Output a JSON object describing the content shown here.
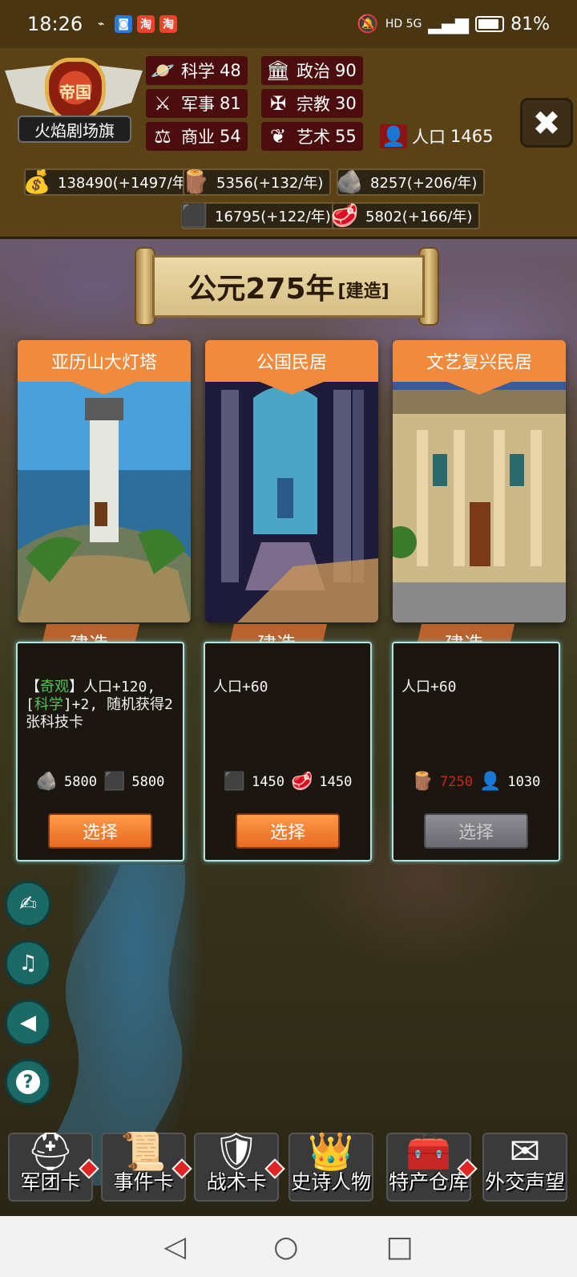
{
  "status_bar": {
    "time": "18:26",
    "apps": [
      "⌁",
      "◙",
      "淘",
      "淘"
    ],
    "battery": "81%",
    "signal": "HD 5G"
  },
  "empire": {
    "shield_label": "帝国",
    "name": "火焰剧场旗"
  },
  "stats": [
    {
      "icon": "science-icon",
      "label": "科学",
      "value": "48"
    },
    {
      "icon": "politics-icon",
      "label": "政治",
      "value": "90"
    },
    {
      "icon": "military-icon",
      "label": "军事",
      "value": "81"
    },
    {
      "icon": "religion-icon",
      "label": "宗教",
      "value": "30"
    },
    {
      "icon": "commerce-icon",
      "label": "商业",
      "value": "54"
    },
    {
      "icon": "art-icon",
      "label": "艺术",
      "value": "55"
    },
    {
      "icon": "population-icon",
      "label": "人口",
      "value": "1465"
    }
  ],
  "resources": [
    {
      "icon": "gold-icon",
      "text": "138490(+1497/年)"
    },
    {
      "icon": "wood-icon",
      "text": "5356(+132/年)"
    },
    {
      "icon": "stone-icon",
      "text": "8257(+206/年)"
    },
    {
      "icon": "iron-icon",
      "text": "16795(+122/年)"
    },
    {
      "icon": "meat-icon",
      "text": "5802(+166/年)"
    }
  ],
  "title_scroll": {
    "era": "公元275年",
    "mode": "[建造]"
  },
  "cards": [
    {
      "title": "亚历山大灯塔",
      "build_label": "建造",
      "desc_parts": [
        "【",
        "奇观",
        "】人口+120,",
        "[",
        "科学",
        "]+2, 随机获得2张科技卡"
      ],
      "costs": [
        {
          "icon": "stone-icon",
          "value": "5800",
          "short": false
        },
        {
          "icon": "iron-icon",
          "value": "5800",
          "short": false
        }
      ],
      "button": "选择",
      "enabled": true
    },
    {
      "title": "公国民居",
      "build_label": "建造",
      "desc": "人口+60",
      "costs": [
        {
          "icon": "iron-icon",
          "value": "1450",
          "short": false
        },
        {
          "icon": "meat-icon",
          "value": "1450",
          "short": false
        }
      ],
      "button": "选择",
      "enabled": true
    },
    {
      "title": "文艺复兴民居",
      "build_label": "建造",
      "desc": "人口+60",
      "costs": [
        {
          "icon": "wood-icon",
          "value": "7250",
          "short": true
        },
        {
          "icon": "population-icon",
          "value": "1030",
          "short": false
        }
      ],
      "button": "选择",
      "enabled": false
    }
  ],
  "side_buttons": [
    {
      "icon": "book-quill-icon"
    },
    {
      "icon": "music-off-icon"
    },
    {
      "icon": "speaker-icon"
    },
    {
      "icon": "help-icon"
    }
  ],
  "bottom_nav": [
    {
      "label": "军团卡",
      "icon": "helmet-icon"
    },
    {
      "label": "事件卡",
      "icon": "scroll-icon"
    },
    {
      "label": "战术卡",
      "icon": "shield-swords-icon"
    },
    {
      "label": "史诗人物",
      "icon": "crown-icon"
    },
    {
      "label": "特产仓库",
      "icon": "chest-icon"
    },
    {
      "label": "外交声望",
      "icon": "letter-icon"
    }
  ],
  "colors": {
    "header_bg": "#5a4116",
    "card_title": "#f08a3c",
    "panel_border": "#b9e3e0",
    "keyword_green": "#4fc24f",
    "insufficient_red": "#c42a1a"
  }
}
